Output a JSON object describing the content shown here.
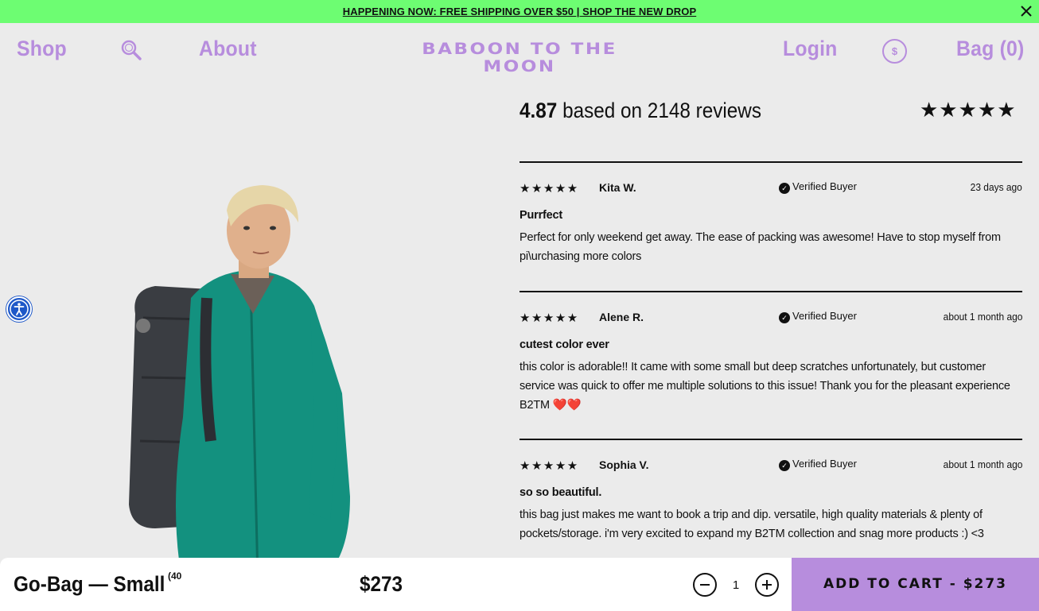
{
  "announcement": {
    "text": "HAPPENING NOW: FREE SHIPPING OVER $50 | SHOP THE NEW DROP"
  },
  "header": {
    "shop": "Shop",
    "about": "About",
    "logo": "BABOON TO THE MOON",
    "login": "Login",
    "currency_symbol": "$",
    "bag": "Bag (0)"
  },
  "reviews_summary": {
    "score": "4.87",
    "text": "based on 2148 reviews",
    "stars": "★★★★★"
  },
  "reviews": [
    {
      "stars": "★★★★★",
      "name": "Kita W.",
      "verified": "Verified Buyer",
      "date": "23 days ago",
      "title": "Purrfect",
      "body": "Perfect for only weekend get away. The ease of packing was awesome! Have to stop myself from pi\\urchasing more colors"
    },
    {
      "stars": "★★★★★",
      "name": "Alene R.",
      "verified": "Verified Buyer",
      "date": "about 1 month ago",
      "title": "cutest color ever",
      "body": "this color is adorable!! It came with some small but deep scratches unfortunately, but customer service was quick to offer me multiple solutions to this issue! Thank you for the pleasant experience B2TM ❤️❤️"
    },
    {
      "stars": "★★★★★",
      "name": "Sophia V.",
      "verified": "Verified Buyer",
      "date": "about 1 month ago",
      "title": "so so beautiful.",
      "body": "this bag just makes me want to book a trip and dip. versatile, high quality materials & plenty of pockets/storage. i'm very excited to expand my B2TM collection and snag more products :) <3"
    }
  ],
  "sticky_bar": {
    "product_name": "Go-Bag — Small",
    "superscript": "(40",
    "price": "$273",
    "quantity": "1",
    "add_to_cart": "ADD TO CART - $273"
  },
  "colors": {
    "announcement_bg": "#6dfd72",
    "brand_purple": "#b78ddd",
    "page_bg": "#ebebeb"
  }
}
